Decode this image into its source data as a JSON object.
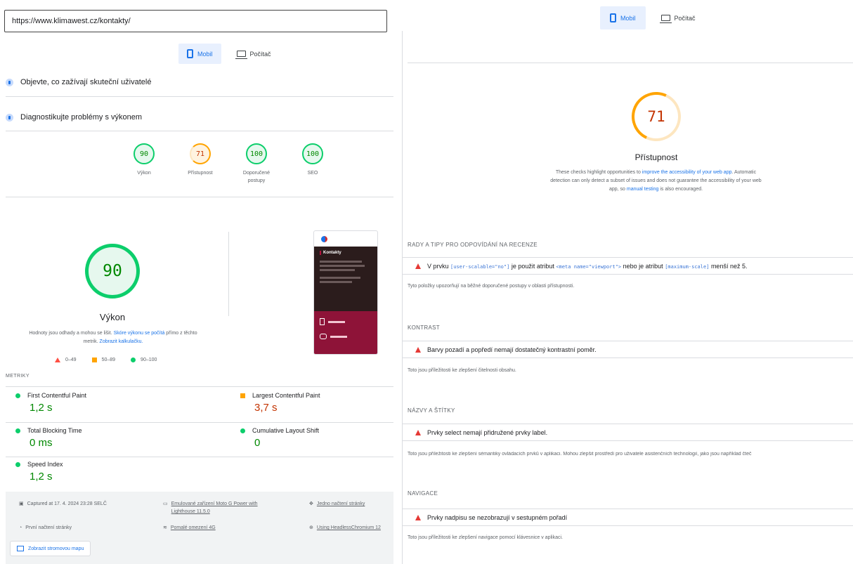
{
  "left": {
    "url": "https://www.klimawest.cz/kontakty/",
    "tabs": [
      {
        "label": "Mobil",
        "active": true
      },
      {
        "label": "Počítač",
        "active": false
      }
    ],
    "section_users": "Objevte, co zažívají skuteční uživatelé",
    "section_diag": "Diagnostikujte problémy s výkonem",
    "scores": [
      {
        "value": "90",
        "label": "Výkon",
        "status": "green"
      },
      {
        "value": "71",
        "label": "Přístupnost",
        "status": "orange"
      },
      {
        "value": "100",
        "label": "Doporučené postupy",
        "status": "green"
      },
      {
        "value": "100",
        "label": "SEO",
        "status": "green"
      }
    ],
    "perf": {
      "score": "90",
      "title": "Výkon",
      "desc_part1": "Hodnoty jsou odhady a mohou se lišit.",
      "desc_link1": "Skóre výkonu se počítá",
      "desc_part2": "přímo z těchto metrik.",
      "desc_link2": "Zobrazit kalkulačku."
    },
    "legend": [
      "0–49",
      "50–89",
      "90–100"
    ],
    "metrics_header": "METRIKY",
    "metrics": [
      {
        "name": "First Contentful Paint",
        "value": "1,2 s",
        "status": "green"
      },
      {
        "name": "Largest Contentful Paint",
        "value": "3,7 s",
        "status": "orange"
      },
      {
        "name": "Total Blocking Time",
        "value": "0 ms",
        "status": "green"
      },
      {
        "name": "Cumulative Layout Shift",
        "value": "0",
        "status": "green"
      },
      {
        "name": "Speed Index",
        "value": "1,2 s",
        "status": "green"
      }
    ],
    "footer": {
      "captured": "Captured at 17. 4. 2024 23:28 SELČ",
      "emulated": "Emulované zařízení Moto G Power with Lighthouse 11.5.0",
      "single_load": "Jedno načtení stránky",
      "first_load": "První načtení stránky",
      "throttling": "Pomalé omezení 4G",
      "browser": "Using HeadlessChromium 12",
      "treemap": "Zobrazit stromovou mapu"
    },
    "phone_preview": {
      "heading": "Kontakty"
    }
  },
  "right": {
    "tabs": [
      {
        "label": "Mobil",
        "active": true
      },
      {
        "label": "Počítač",
        "active": false
      }
    ],
    "score": "71",
    "title": "Přístupnost",
    "desc": {
      "p1": "These checks highlight opportunities to",
      "l1": "improve the accessibility of your web app",
      "p2": ". Automatic detection can only detect a subset of issues and does not guarantee the accessibility of your web app, so",
      "l2": "manual testing",
      "p3": "is also encouraged."
    },
    "groups": [
      {
        "category": "RADY A TIPY PRO ODPOVÍDÁNÍ NA RECENZE",
        "audit_pre": "V prvku",
        "code1": "[user-scalable=\"no\"]",
        "audit_mid1": "je použit atribut",
        "code2": "<meta name=\"viewport\">",
        "audit_mid2": "nebo je atribut",
        "code3": "[maximum-scale]",
        "audit_post": "menší než 5.",
        "note": "Tyto položky upozorňují na běžné doporučené postupy v oblasti přístupnosti."
      },
      {
        "category": "KONTRAST",
        "audit": "Barvy pozadí a popředí nemají dostatečný kontrastní poměr.",
        "note": "Toto jsou příležitosti ke zlepšení čitelnosti obsahu."
      },
      {
        "category": "NÁZVY A ŠTÍTKY",
        "audit": "Prvky select nemají přidružené prvky label.",
        "note": "Toto jsou příležitosti ke zlepšení sémantiky ovládacích prvků v aplikaci. Mohou zlepšit prostředí pro uživatele asistenčních technologií, jako jsou například čteč"
      },
      {
        "category": "NAVIGACE",
        "audit": "Prvky nadpisu se nezobrazují v sestupném pořadí",
        "note": "Toto jsou příležitosti ke zlepšení navigace pomocí klávesnice v aplikaci."
      }
    ]
  }
}
